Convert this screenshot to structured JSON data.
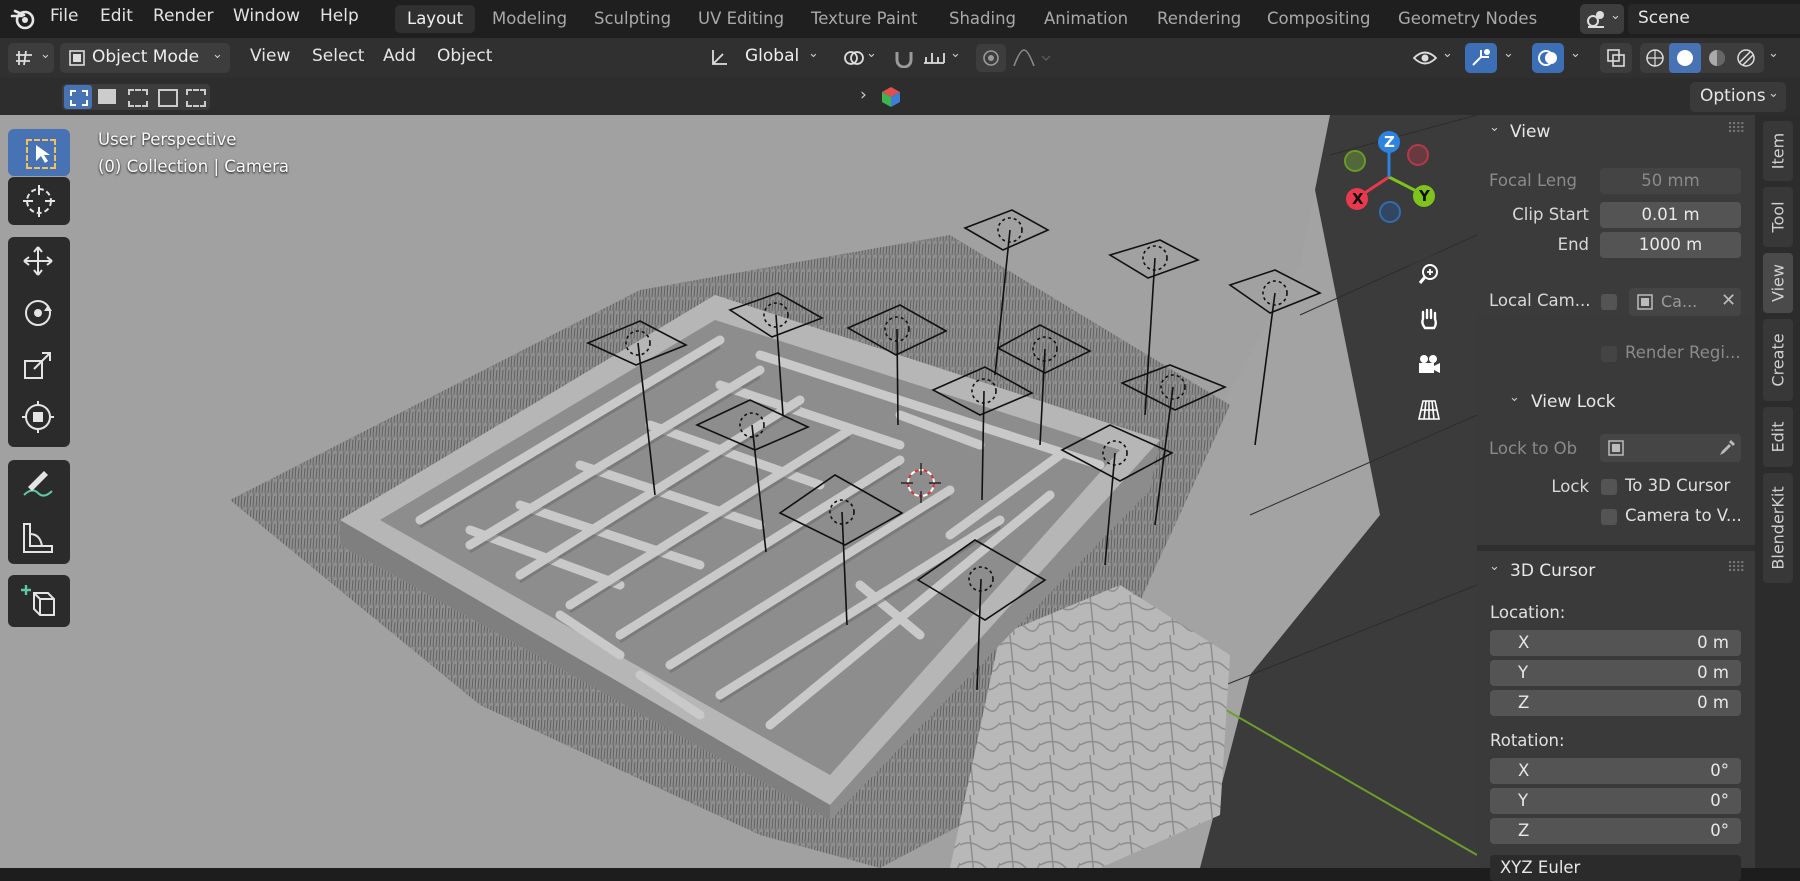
{
  "topbar": {
    "menus": [
      "File",
      "Edit",
      "Render",
      "Window",
      "Help"
    ],
    "workspaces": [
      "Layout",
      "Modeling",
      "Sculpting",
      "UV Editing",
      "Texture Paint",
      "Shading",
      "Animation",
      "Rendering",
      "Compositing",
      "Geometry Nodes"
    ],
    "active_workspace": "Layout",
    "scene_name": "Scene"
  },
  "header": {
    "mode": "Object Mode",
    "menus": [
      "View",
      "Select",
      "Add",
      "Object"
    ],
    "orientation": "Global"
  },
  "options_label": "Options",
  "viewport": {
    "perspective_label": "User Perspective",
    "collection_label": "(0) Collection | Camera",
    "gizmo_axes": {
      "x": "X",
      "y": "Y",
      "z": "Z"
    },
    "axis_colors": {
      "x": "#e8394f",
      "y": "#7fc41c",
      "z": "#2e82e0"
    }
  },
  "npanel": {
    "view_title": "View",
    "focal_length_label": "Focal Leng",
    "focal_length_value": "50 mm",
    "clip_start_label": "Clip Start",
    "clip_start_value": "0.01 m",
    "end_label": "End",
    "end_value": "1000 m",
    "local_camera_label": "Local Cam...",
    "local_camera_value": "Ca...",
    "render_region_label": "Render Regi...",
    "view_lock_title": "View Lock",
    "lock_to_object_label": "Lock to Ob",
    "lock_label": "Lock",
    "to_3d_cursor_label": "To 3D Cursor",
    "camera_to_view_label": "Camera to V...",
    "cursor_title": "3D Cursor",
    "location_label": "Location:",
    "location": [
      {
        "axis": "X",
        "value": "0 m"
      },
      {
        "axis": "Y",
        "value": "0 m"
      },
      {
        "axis": "Z",
        "value": "0 m"
      }
    ],
    "rotation_label": "Rotation:",
    "rotation": [
      {
        "axis": "X",
        "value": "0°"
      },
      {
        "axis": "Y",
        "value": "0°"
      },
      {
        "axis": "Z",
        "value": "0°"
      }
    ],
    "rotation_mode": "XYZ Euler"
  },
  "side_tabs": [
    "Item",
    "Tool",
    "View",
    "Create",
    "Edit",
    "BlenderKit"
  ],
  "active_side_tab": "View",
  "colors": {
    "accent_blue": "#4772b3",
    "viewport_bg": "#a3a3a3",
    "panel_bg": "#3a3a3a"
  }
}
